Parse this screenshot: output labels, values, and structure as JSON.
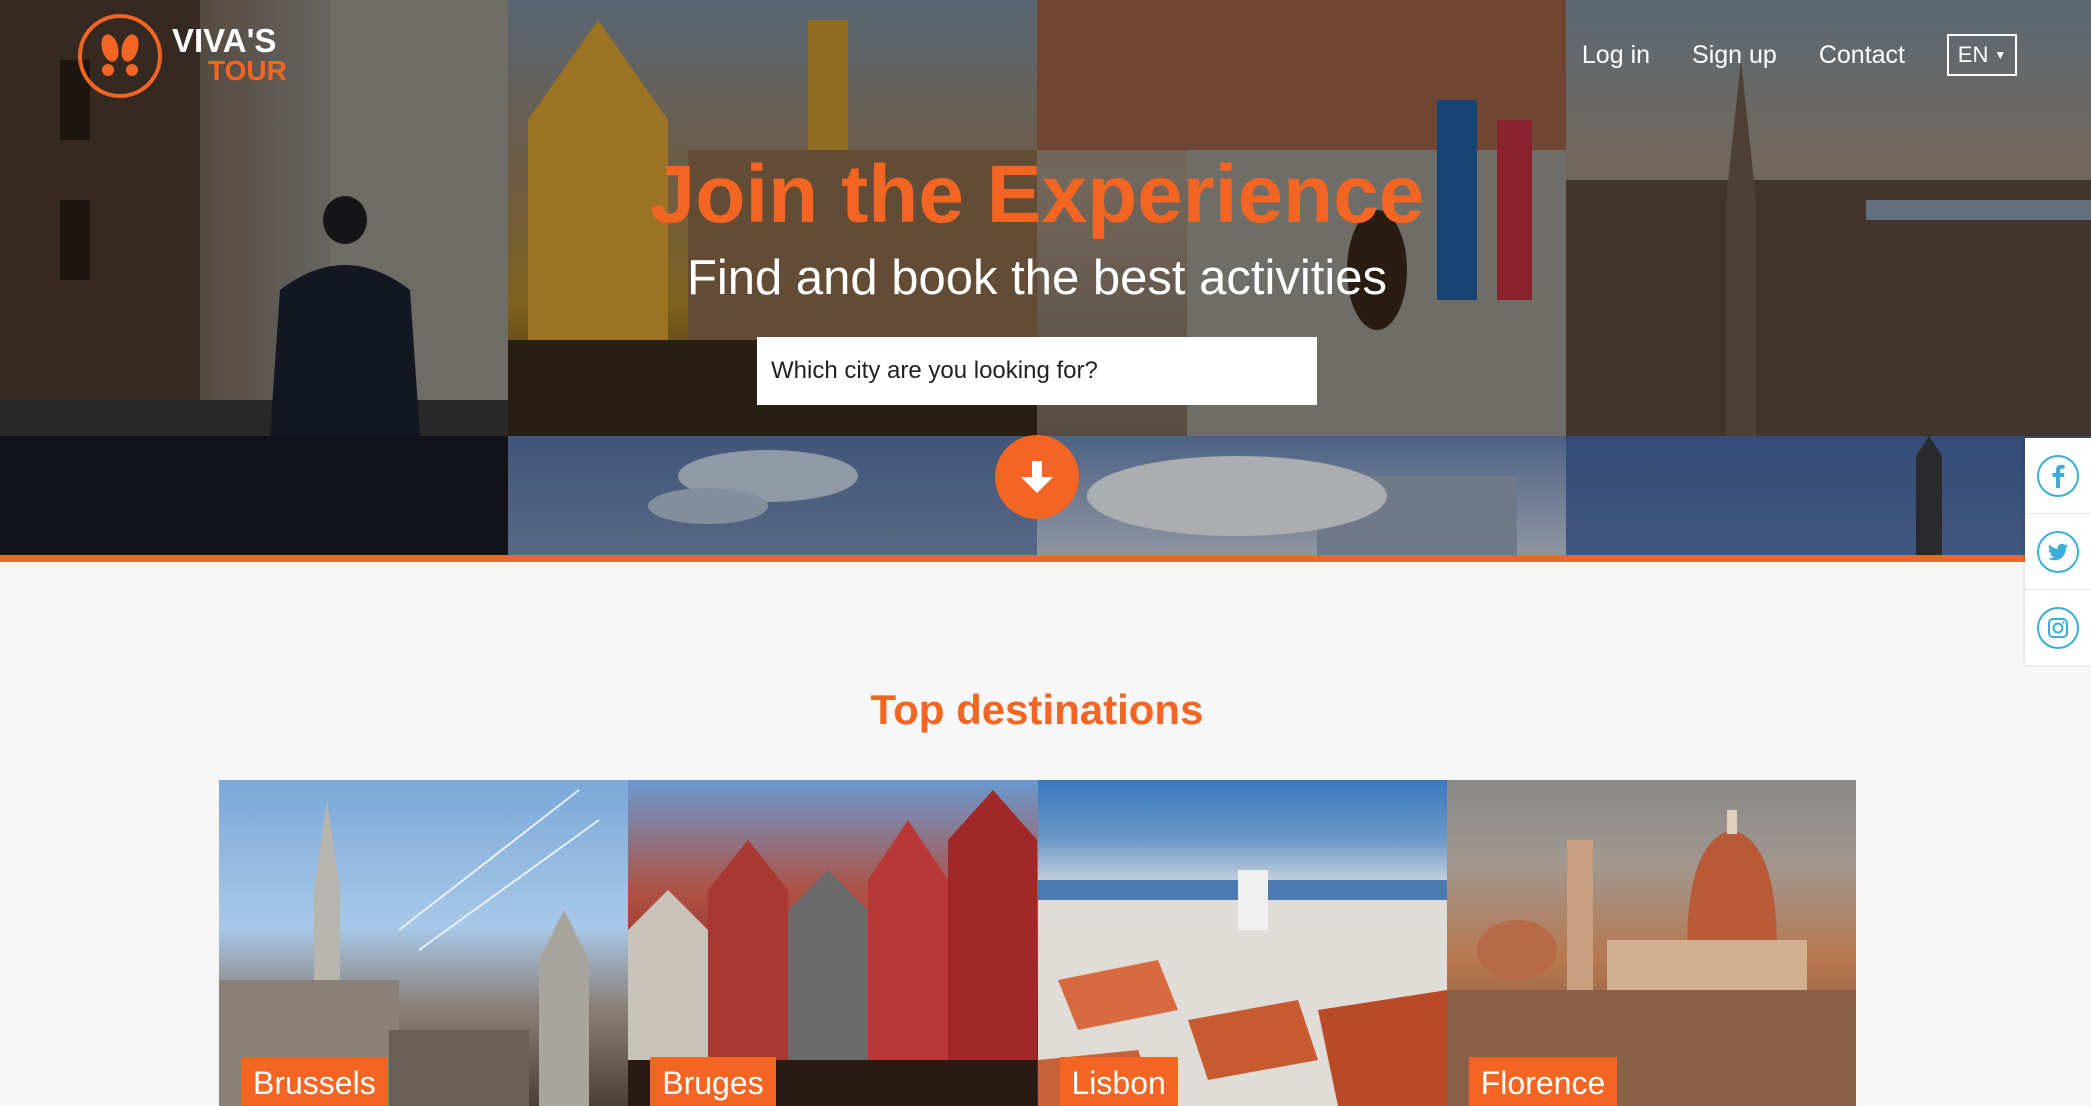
{
  "brand": {
    "line1": "VIVA'S",
    "line2": "TOUR"
  },
  "nav": {
    "login": "Log in",
    "signup": "Sign up",
    "contact": "Contact",
    "language": "EN"
  },
  "hero": {
    "title": "Join the Experience",
    "subtitle": "Find and book the best activities",
    "search_placeholder": "Which city are you looking for?"
  },
  "social": [
    "facebook-icon",
    "twitter-icon",
    "instagram-icon"
  ],
  "destinations": {
    "title": "Top destinations",
    "items": [
      {
        "name": "Brussels"
      },
      {
        "name": "Bruges"
      },
      {
        "name": "Lisbon"
      },
      {
        "name": "Florence"
      }
    ]
  },
  "colors": {
    "accent": "#f26522",
    "social_icon": "#3aaed8"
  }
}
